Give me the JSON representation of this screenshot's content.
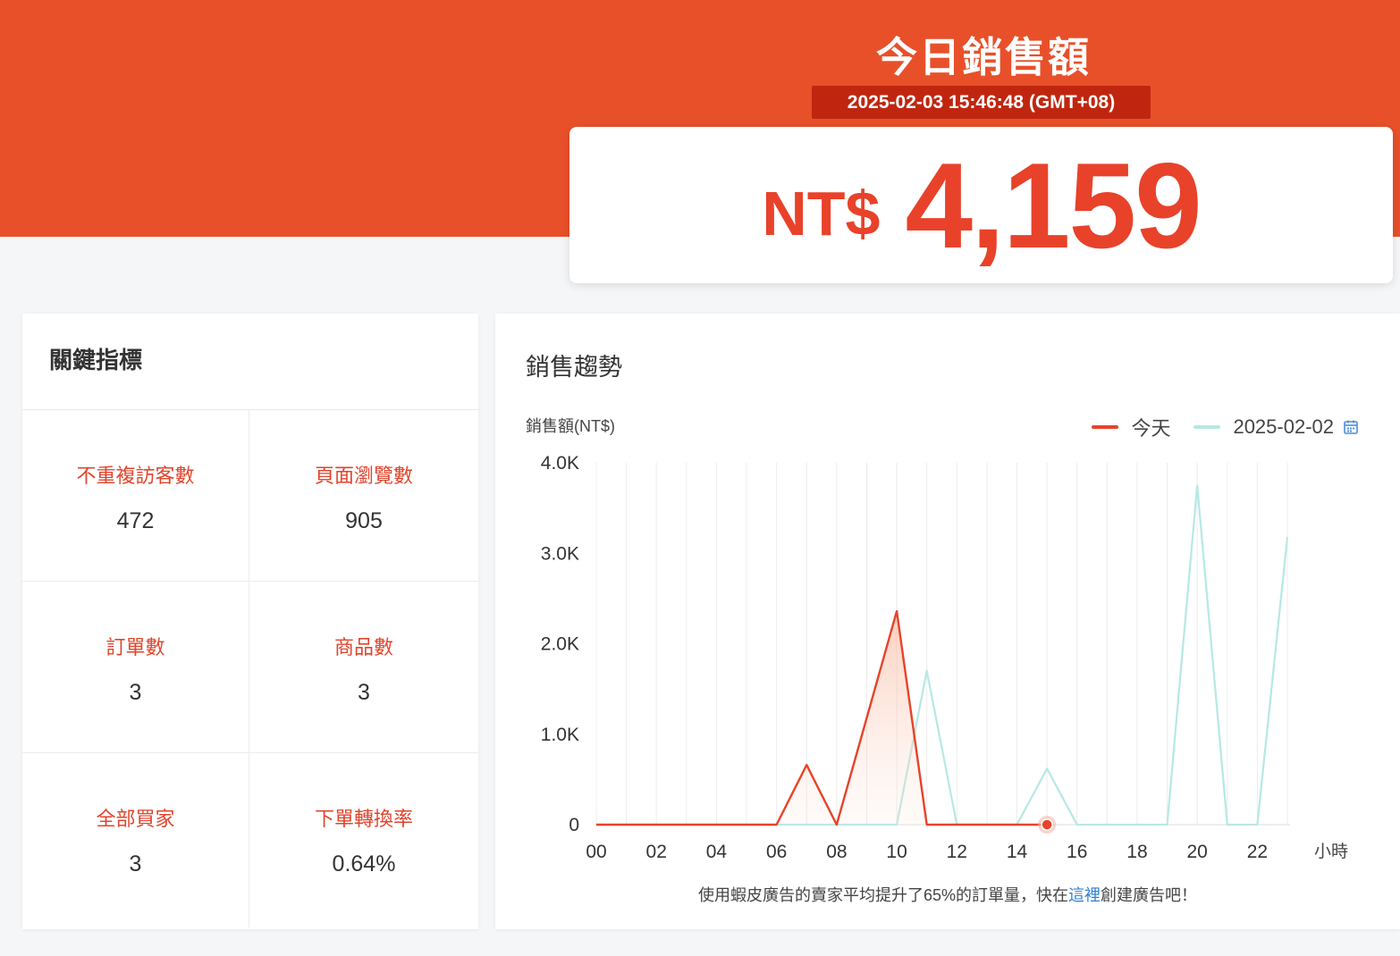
{
  "header": {
    "title": "今日銷售額",
    "timestamp": "2025-02-03 15:46:48 (GMT+08)",
    "currency": "NT$",
    "total": "4,159"
  },
  "kpi": {
    "title": "關鍵指標",
    "items": [
      {
        "label": "不重複訪客數",
        "value": "472"
      },
      {
        "label": "頁面瀏覽數",
        "value": "905"
      },
      {
        "label": "訂單數",
        "value": "3"
      },
      {
        "label": "商品數",
        "value": "3"
      },
      {
        "label": "全部買家",
        "value": "3"
      },
      {
        "label": "下單轉換率",
        "value": "0.64%"
      }
    ]
  },
  "trend": {
    "title": "銷售趨勢",
    "footer_before": "使用蝦皮廣告的賣家平均提升了65%的訂單量，快在",
    "footer_link": "這裡",
    "footer_after": "創建廣告吧！"
  },
  "chart_data": {
    "type": "line",
    "ylabel": "銷售額(NT$)",
    "xlabel": "小時",
    "x": [
      0,
      1,
      2,
      3,
      4,
      5,
      6,
      7,
      8,
      9,
      10,
      11,
      12,
      13,
      14,
      15,
      16,
      17,
      18,
      19,
      20,
      21,
      22,
      23
    ],
    "x_tick_labels": [
      "00",
      "02",
      "04",
      "06",
      "08",
      "10",
      "12",
      "14",
      "16",
      "18",
      "20",
      "22"
    ],
    "y_ticks": [
      0,
      1000,
      2000,
      3000,
      4000
    ],
    "y_tick_labels": [
      "0",
      "1.0K",
      "2.0K",
      "3.0K",
      "4.0K"
    ],
    "ylim": [
      0,
      4000
    ],
    "xlim": [
      0,
      23
    ],
    "series": [
      {
        "name": "今天",
        "color": "#e8422a",
        "values": [
          0,
          0,
          0,
          0,
          0,
          0,
          0,
          660,
          0,
          1180,
          2360,
          0,
          0,
          0,
          0,
          0
        ]
      },
      {
        "name": "2025-02-02",
        "color": "#b7e8e3",
        "values": [
          0,
          0,
          0,
          0,
          0,
          0,
          0,
          0,
          0,
          0,
          0,
          1700,
          0,
          0,
          0,
          620,
          0,
          0,
          0,
          0,
          3750,
          0,
          0,
          3180
        ]
      }
    ],
    "highlight_point": {
      "series": "今天",
      "x": 15,
      "y": 0
    },
    "grid": "vertical",
    "legend_position": "top-right"
  }
}
